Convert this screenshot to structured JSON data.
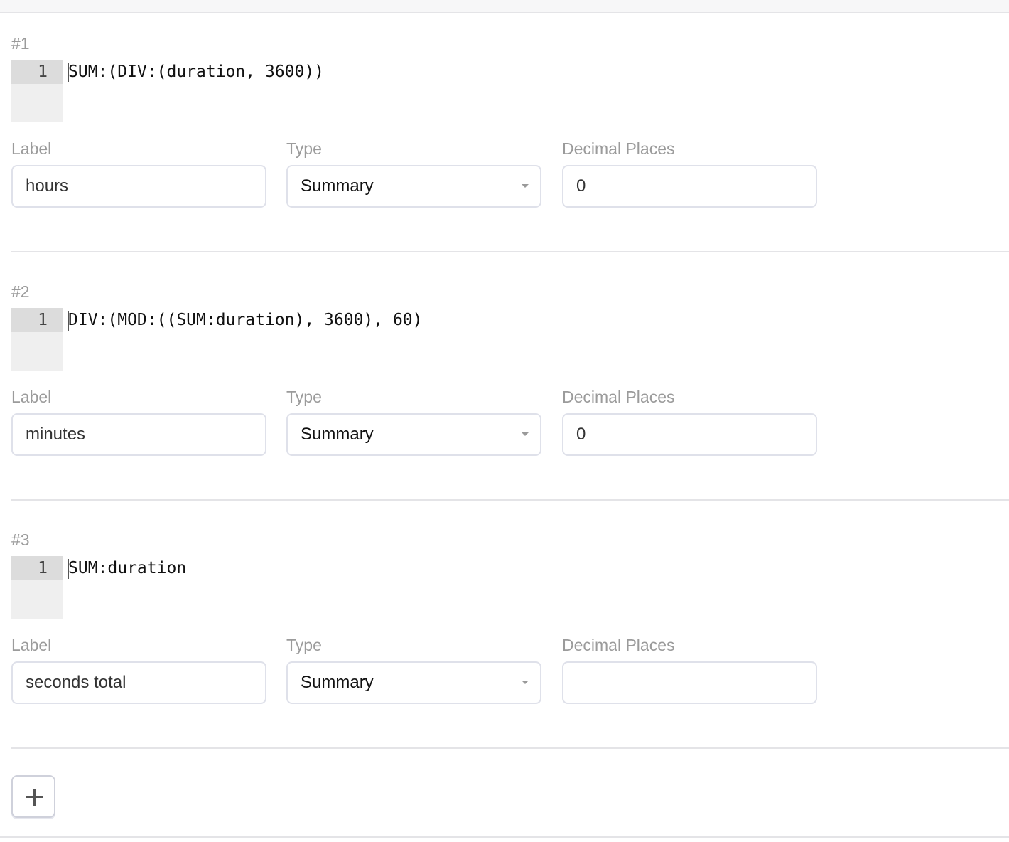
{
  "labels": {
    "label": "Label",
    "type": "Type",
    "decimal_places": "Decimal Places"
  },
  "columns": [
    {
      "number": "#1",
      "line_number": "1",
      "formula": "SUM:(DIV:(duration, 3600))",
      "label_value": "hours",
      "type_value": "Summary",
      "decimal_places_value": "0"
    },
    {
      "number": "#2",
      "line_number": "1",
      "formula": "DIV:(MOD:((SUM:duration), 3600), 60)",
      "label_value": "minutes",
      "type_value": "Summary",
      "decimal_places_value": "0"
    },
    {
      "number": "#3",
      "line_number": "1",
      "formula": "SUM:duration",
      "label_value": "seconds total",
      "type_value": "Summary",
      "decimal_places_value": ""
    }
  ],
  "add_button": {
    "icon": "plus-icon"
  }
}
